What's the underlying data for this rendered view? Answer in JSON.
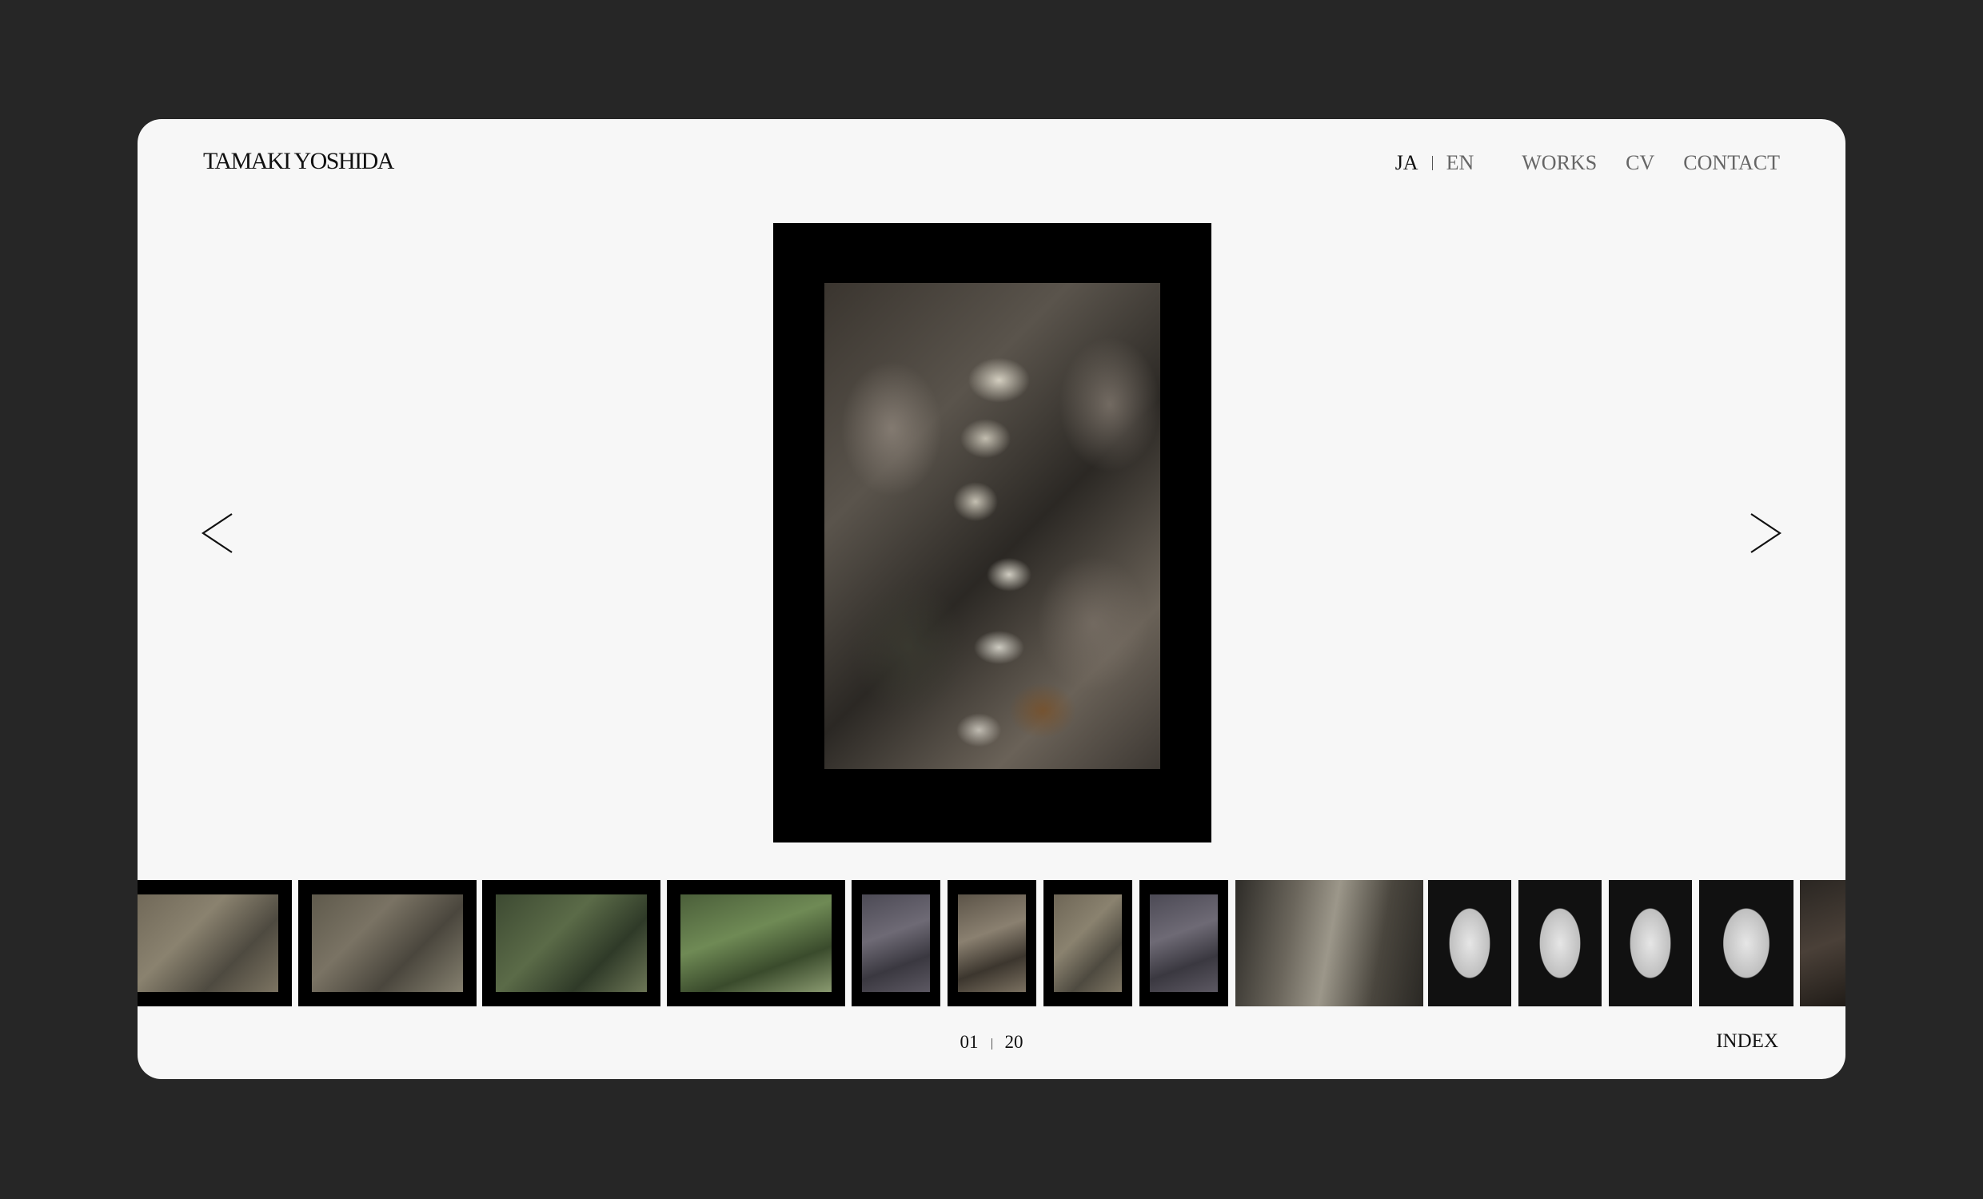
{
  "brand": {
    "name": "TAMAKI YOSHIDA"
  },
  "nav": {
    "lang_ja": "JA",
    "lang_en": "EN",
    "active_lang": "JA",
    "links": [
      {
        "label": "WORKS"
      },
      {
        "label": "CV"
      },
      {
        "label": "CONTACT"
      }
    ]
  },
  "viewer": {
    "prev_icon": "chevron-left-icon",
    "next_icon": "chevron-right-icon",
    "current_artwork": "fungus-on-mossy-ground-photograph"
  },
  "thumbnails": [
    {
      "subject": "moss-ground"
    },
    {
      "subject": "moss-ground"
    },
    {
      "subject": "green-moss"
    },
    {
      "subject": "grass"
    },
    {
      "subject": "dark-leaves"
    },
    {
      "subject": "fungus",
      "active": true
    },
    {
      "subject": "moss-ground"
    },
    {
      "subject": "leaves"
    },
    {
      "subject": "rock-face"
    },
    {
      "subject": "white-stone"
    },
    {
      "subject": "white-stone"
    },
    {
      "subject": "white-stone"
    },
    {
      "subject": "white-stones-cluster"
    },
    {
      "subject": "dark-ground"
    }
  ],
  "pagination": {
    "current": "01",
    "total": "20",
    "index_label": "INDEX"
  },
  "colors": {
    "background": "#262626",
    "card": "#f7f7f7",
    "text": "#111111",
    "muted": "#666666",
    "frame": "#000000"
  }
}
